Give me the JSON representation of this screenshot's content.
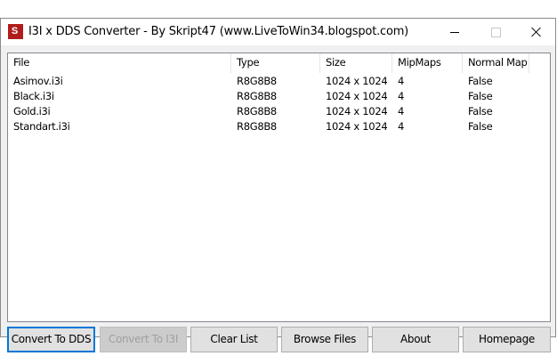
{
  "window": {
    "title": "I3I x DDS Converter - By Skript47 (www.LiveToWin34.blogspot.com)",
    "icon_text": "S"
  },
  "table": {
    "columns": [
      "File",
      "Type",
      "Size",
      "MipMaps",
      "Normal Map"
    ],
    "rows": [
      [
        "Asimov.i3i",
        "R8G8B8",
        "1024 x 1024",
        "4",
        "False"
      ],
      [
        "Black.i3i",
        "R8G8B8",
        "1024 x 1024",
        "4",
        "False"
      ],
      [
        "Gold.i3i",
        "R8G8B8",
        "1024 x 1024",
        "4",
        "False"
      ],
      [
        "Standart.i3i",
        "R8G8B8",
        "1024 x 1024",
        "4",
        "False"
      ]
    ]
  },
  "buttons": {
    "convert_to_dds": "Convert To DDS",
    "convert_to_i3i": "Convert To I3I",
    "clear_list": "Clear List",
    "browse_files": "Browse Files",
    "about": "About",
    "homepage": "Homepage"
  },
  "colors": {
    "accent": "#0078d7",
    "icon_bg": "#b01c1c"
  }
}
